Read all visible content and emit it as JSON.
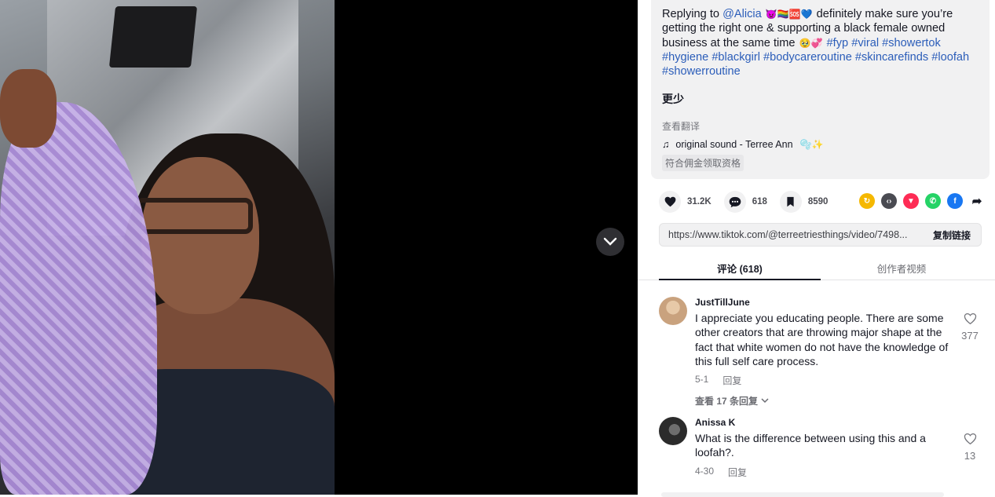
{
  "description": {
    "prefix": "Replying to ",
    "mention": "@Alicia",
    "emojis_after_mention": "👿🏳️‍🌈🆘💙",
    "body": " definitely make sure you’re getting the right one & supporting a black female owned business at the same time ",
    "emojis_after_body": "🥹💞",
    "hashtags": [
      "#fyp",
      "#viral",
      "#showertok",
      "#hygiene",
      "#blackgirl",
      "#bodycareroutine",
      "#skincarefinds",
      "#loofah",
      "#showerroutine"
    ]
  },
  "less_label": "更少",
  "translate_label": "查看翻译",
  "sound": {
    "icon": "music-note-icon",
    "label": "original sound - Terree Ann",
    "emojis": "🫧✨"
  },
  "commission_label": "符合佣金领取资格",
  "actions": {
    "likes": "31.2K",
    "comments": "618",
    "saves": "8590"
  },
  "share_icons": [
    {
      "name": "repost-icon",
      "color": "#f5b800",
      "glyph": "↻"
    },
    {
      "name": "embed-icon",
      "color": "#4a4b52",
      "glyph": "‹›"
    },
    {
      "name": "send-icon",
      "color": "#fe2c55",
      "glyph": "▼"
    },
    {
      "name": "whatsapp-icon",
      "color": "#25d366",
      "glyph": "✆"
    },
    {
      "name": "facebook-icon",
      "color": "#1877f2",
      "glyph": "f"
    },
    {
      "name": "share-arrow-icon",
      "color": "#ffffff",
      "glyph": "➦"
    }
  ],
  "link": {
    "url": "https://www.tiktok.com/@terreetriesthings/video/7498...",
    "copy_label": "复制链接"
  },
  "tabs": {
    "comments": "评论 (618)",
    "creator_videos": "创作者视频"
  },
  "comments": [
    {
      "username": "JustTillJune",
      "text": "I appreciate you educating people. There are some other creators that are throwing major shape at the fact that white women do not have the knowledge of this full self care process.",
      "date": "5-1",
      "reply_label": "回复",
      "more_replies": "查看 17 条回复",
      "likes": "377",
      "avatar_color": "#c9a27e"
    },
    {
      "username": "Anissa K",
      "text": "What is the difference between using this and a loofah?.",
      "date": "4-30",
      "reply_label": "回复",
      "likes": "13",
      "avatar_color": "#3a3a3a"
    }
  ]
}
